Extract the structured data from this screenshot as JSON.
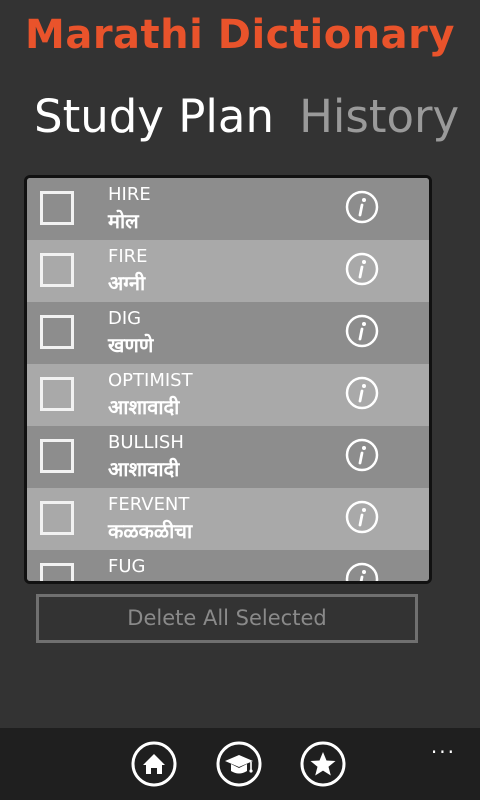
{
  "app": {
    "title": "Marathi Dictionary"
  },
  "pivot": {
    "active": "Study Plan",
    "inactive": "History"
  },
  "list": {
    "rows": [
      {
        "word": "HIRE",
        "meaning": "मोल"
      },
      {
        "word": "FIRE",
        "meaning": "अग्नी"
      },
      {
        "word": "DIG",
        "meaning": "खणणे"
      },
      {
        "word": "OPTIMIST",
        "meaning": "आशावादी"
      },
      {
        "word": "BULLISH",
        "meaning": "आशावादी"
      },
      {
        "word": "FERVENT",
        "meaning": "कळकळीचा"
      },
      {
        "word": "FUG",
        "meaning": ""
      }
    ]
  },
  "actions": {
    "delete_label": "Delete All Selected"
  },
  "appbar": {
    "icons": [
      "home-icon",
      "graduation-cap-icon",
      "star-icon"
    ],
    "more_label": "..."
  },
  "colors": {
    "accent": "#E9532B",
    "background": "#333333",
    "row_dark": "#8d8d8d",
    "row_light": "#a9a9a9"
  }
}
